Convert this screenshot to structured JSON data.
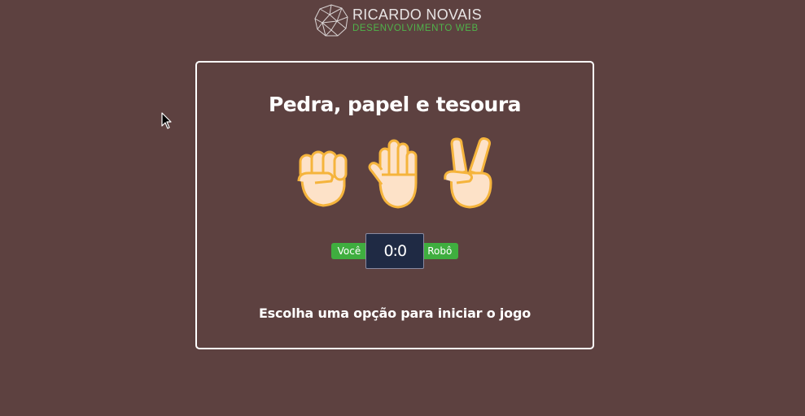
{
  "logo": {
    "name": "RICARDO NOVAIS",
    "subtitle": "DESENVOLVIMENTO WEB",
    "icon": "low-poly-globe-icon",
    "accent": "#4fb34a"
  },
  "game": {
    "title": "Pedra, papel e tesoura",
    "options": [
      {
        "label": "Pedra",
        "icon": "raised-fist-icon"
      },
      {
        "label": "Papel",
        "icon": "raised-hand-icon"
      },
      {
        "label": "Tesoura",
        "icon": "victory-hand-icon"
      }
    ],
    "score": {
      "player_label": "Você",
      "score_text": "0:0",
      "robot_label": "Robô"
    },
    "message": "Escolha uma opção para iniciar o jogo"
  },
  "colors": {
    "background": "#5d4140",
    "tag_green": "#3fae3f",
    "score_bg": "#1f2a44",
    "skin": "#fde2c8",
    "skin_outline": "#f5b43c"
  }
}
